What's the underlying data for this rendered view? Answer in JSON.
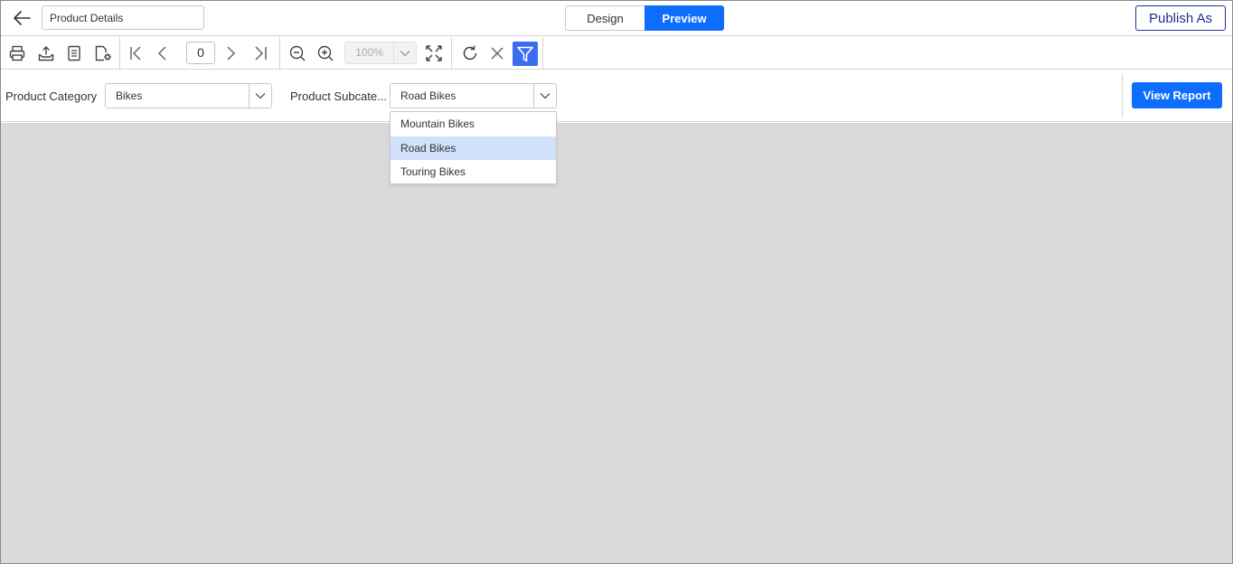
{
  "header": {
    "report_name": "Product Details",
    "tabs": [
      {
        "label": "Design",
        "active": false
      },
      {
        "label": "Preview",
        "active": true
      }
    ],
    "publish_label": "Publish As"
  },
  "toolbar": {
    "icons": [
      "print-icon",
      "export-icon",
      "page-setup-icon",
      "settings-icon",
      "first-page-icon",
      "previous-page-icon",
      "next-page-icon",
      "last-page-icon",
      "zoom-out-icon",
      "zoom-in-icon",
      "fit-page-icon",
      "refresh-icon",
      "cancel-icon",
      "filter-icon"
    ],
    "page_number": "0",
    "zoom": "100%"
  },
  "parameters": {
    "category_label": "Product Category",
    "category_value": "Bikes",
    "subcategory_label": "Product Subcate...",
    "subcategory_value": "Road Bikes",
    "subcategory_options": [
      "Mountain Bikes",
      "Road Bikes",
      "Touring Bikes"
    ],
    "view_report_label": "View Report"
  },
  "colors": {
    "accent": "#0d6efd",
    "filter_active": "#3d6cf0",
    "publish_border": "#1e2f8f",
    "canvas": "#dadada",
    "selected_option": "#d2e1fb"
  }
}
